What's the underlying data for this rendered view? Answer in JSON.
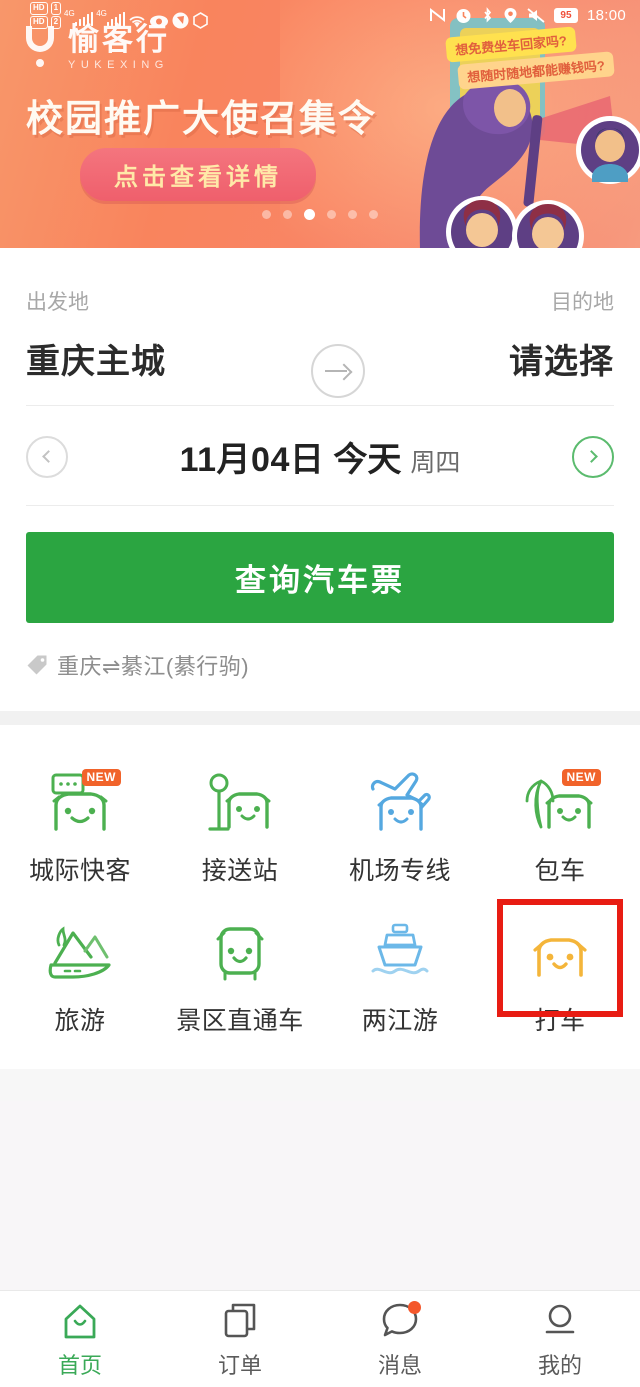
{
  "status_bar": {
    "hd_label": "HD",
    "hd_label2": "HD",
    "network_4g": "4G",
    "network_4g_2": "4G",
    "battery": "95",
    "time": "18:00",
    "icons": [
      "hd-icon",
      "sim-icon",
      "signal-icon",
      "wifi-icon",
      "eye-icon",
      "shield-icon",
      "hexagon-icon",
      "nfc-icon",
      "alarm-icon",
      "bluetooth-icon",
      "location-icon",
      "mute-icon",
      "battery-icon"
    ]
  },
  "banner": {
    "logo_cn": "愉客行",
    "logo_en": "YUKEXING",
    "title": "校园推广大使召集令",
    "cta": "点击查看详情",
    "bubble1": "想免费坐车回家吗?",
    "bubble2": "想随时随地都能赚钱吗?",
    "dot_count": 6,
    "active_dot": 3,
    "bg_color": "#f8845f"
  },
  "search": {
    "origin_label": "出发地",
    "origin_value": "重庆主城",
    "destination_label": "目的地",
    "destination_value": "请选择",
    "swap_icon": "swap-arrow-icon",
    "date_prev_icon": "chevron-left-icon",
    "date_next_icon": "chevron-right-icon",
    "date_main": "11月04日",
    "date_today": "今天",
    "date_week": "周四",
    "search_button": "查询汽车票",
    "route_tag": "重庆⇌綦江(綦行驹)",
    "button_color": "#2ba541"
  },
  "grid": {
    "rows": [
      [
        {
          "label": "城际快客",
          "icon": "intercity-bus-icon",
          "badge": "NEW",
          "color": "#4cb050"
        },
        {
          "label": "接送站",
          "icon": "station-shuttle-icon",
          "badge": "",
          "color": "#4cb050"
        },
        {
          "label": "机场专线",
          "icon": "airport-line-icon",
          "badge": "",
          "color": "#55a8e0"
        },
        {
          "label": "包车",
          "icon": "charter-bus-icon",
          "badge": "NEW",
          "color": "#4cb050"
        }
      ],
      [
        {
          "label": "旅游",
          "icon": "travel-mountain-icon",
          "badge": "",
          "color": "#4cb050"
        },
        {
          "label": "景区直通车",
          "icon": "scenic-shuttle-icon",
          "badge": "",
          "color": "#4cb050"
        },
        {
          "label": "两江游",
          "icon": "river-cruise-icon",
          "badge": "",
          "color": "#6cb8e8"
        },
        {
          "label": "打车",
          "icon": "taxi-icon",
          "badge": "",
          "color": "#f4b53a",
          "highlighted": true
        }
      ]
    ],
    "highlight_color": "#e81c13"
  },
  "tabbar": {
    "items": [
      {
        "label": "首页",
        "icon": "home-icon",
        "active": true,
        "dot": false
      },
      {
        "label": "订单",
        "icon": "orders-icon",
        "active": false,
        "dot": false
      },
      {
        "label": "消息",
        "icon": "message-icon",
        "active": false,
        "dot": true
      },
      {
        "label": "我的",
        "icon": "profile-icon",
        "active": false,
        "dot": false
      }
    ],
    "active_color": "#3aa957"
  }
}
